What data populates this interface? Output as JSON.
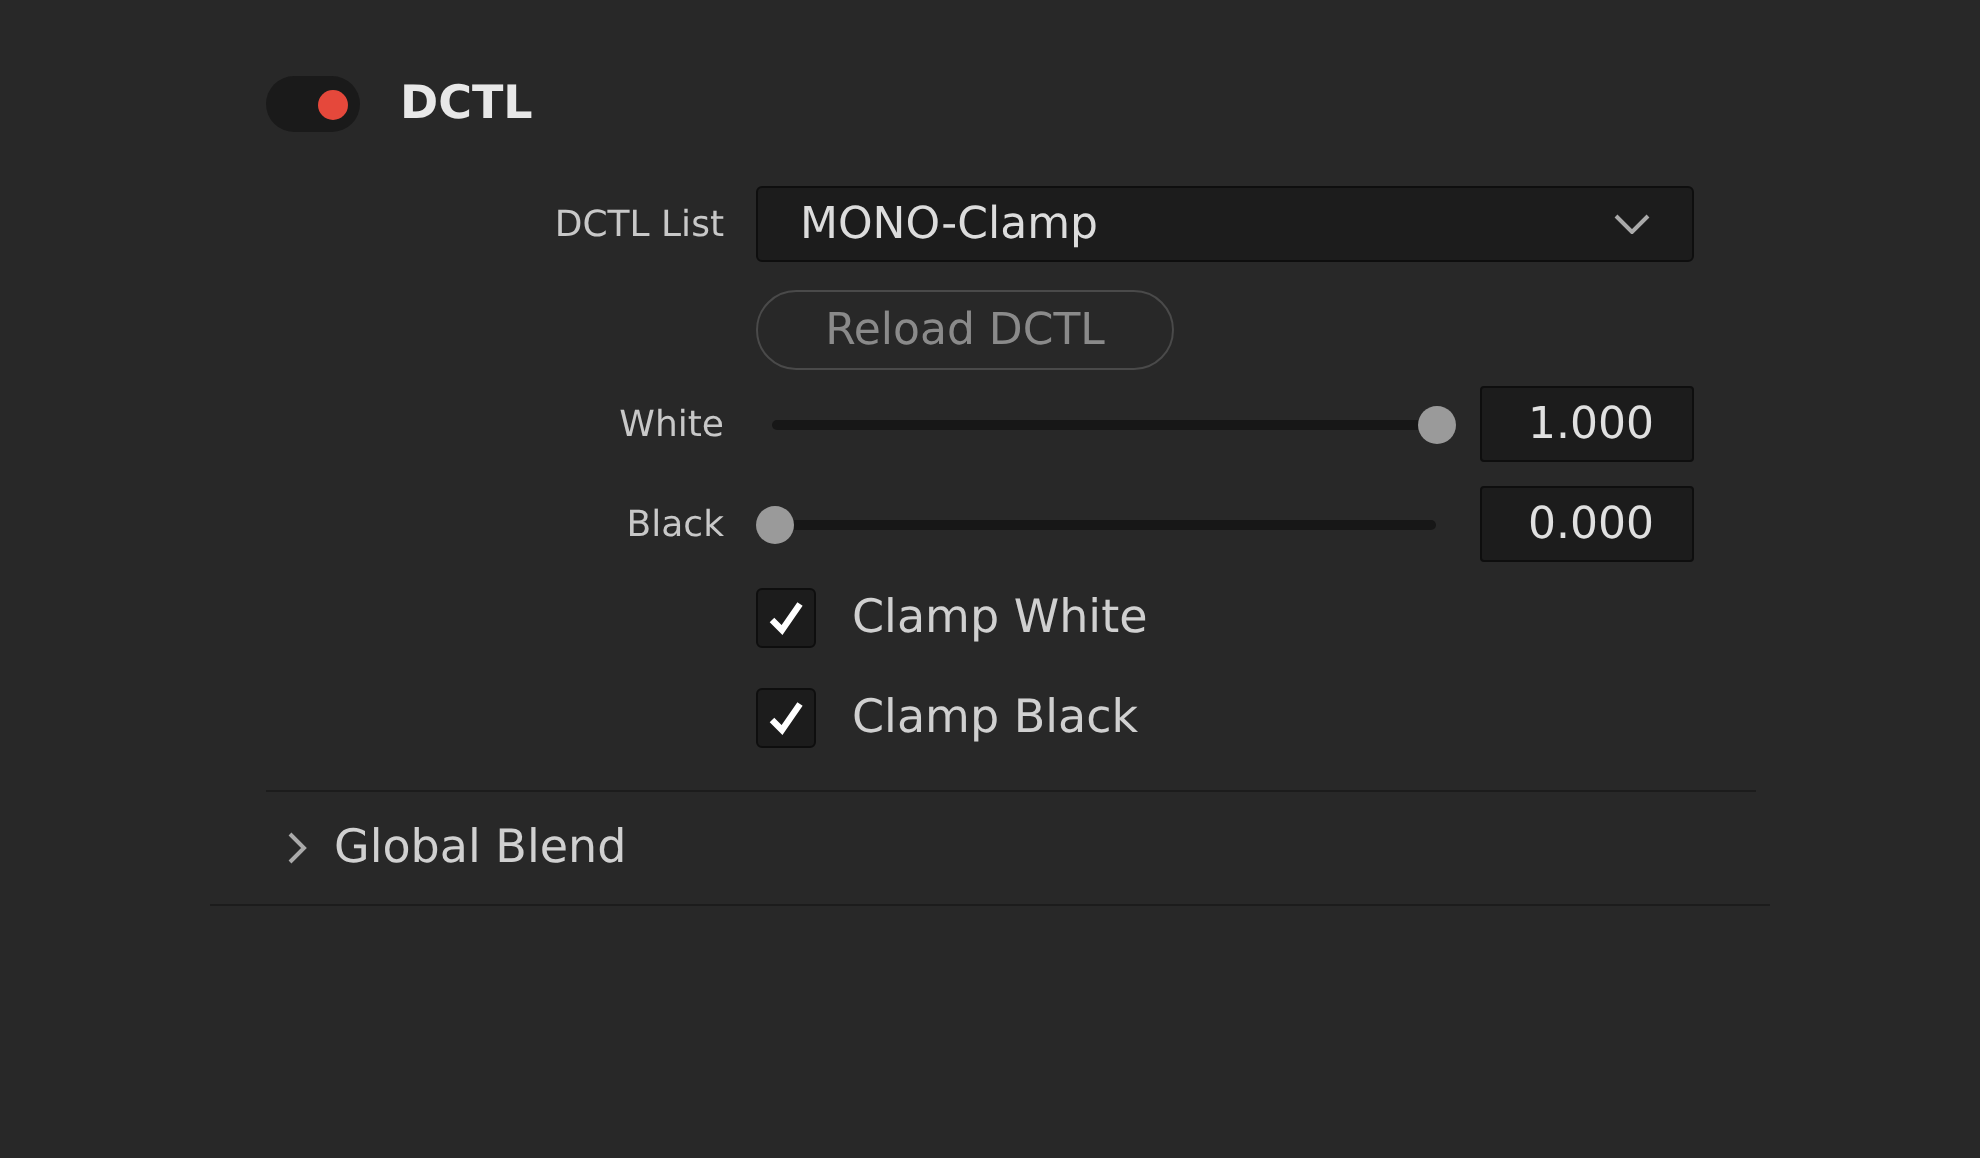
{
  "section": {
    "title": "DCTL",
    "enabled": true
  },
  "dctl_list": {
    "label": "DCTL List",
    "value": "MONO-Clamp"
  },
  "reload_button": {
    "label": "Reload DCTL",
    "disabled": true
  },
  "sliders": [
    {
      "label": "White",
      "level": 1,
      "reading": "1.000"
    },
    {
      "label": "Black",
      "level": 0,
      "reading": "0.000"
    }
  ],
  "checkboxes": [
    {
      "label": "Clamp White",
      "checked": true
    },
    {
      "label": "Clamp Black",
      "checked": true
    }
  ],
  "global_blend": {
    "label": "Global Blend",
    "expanded": false
  }
}
